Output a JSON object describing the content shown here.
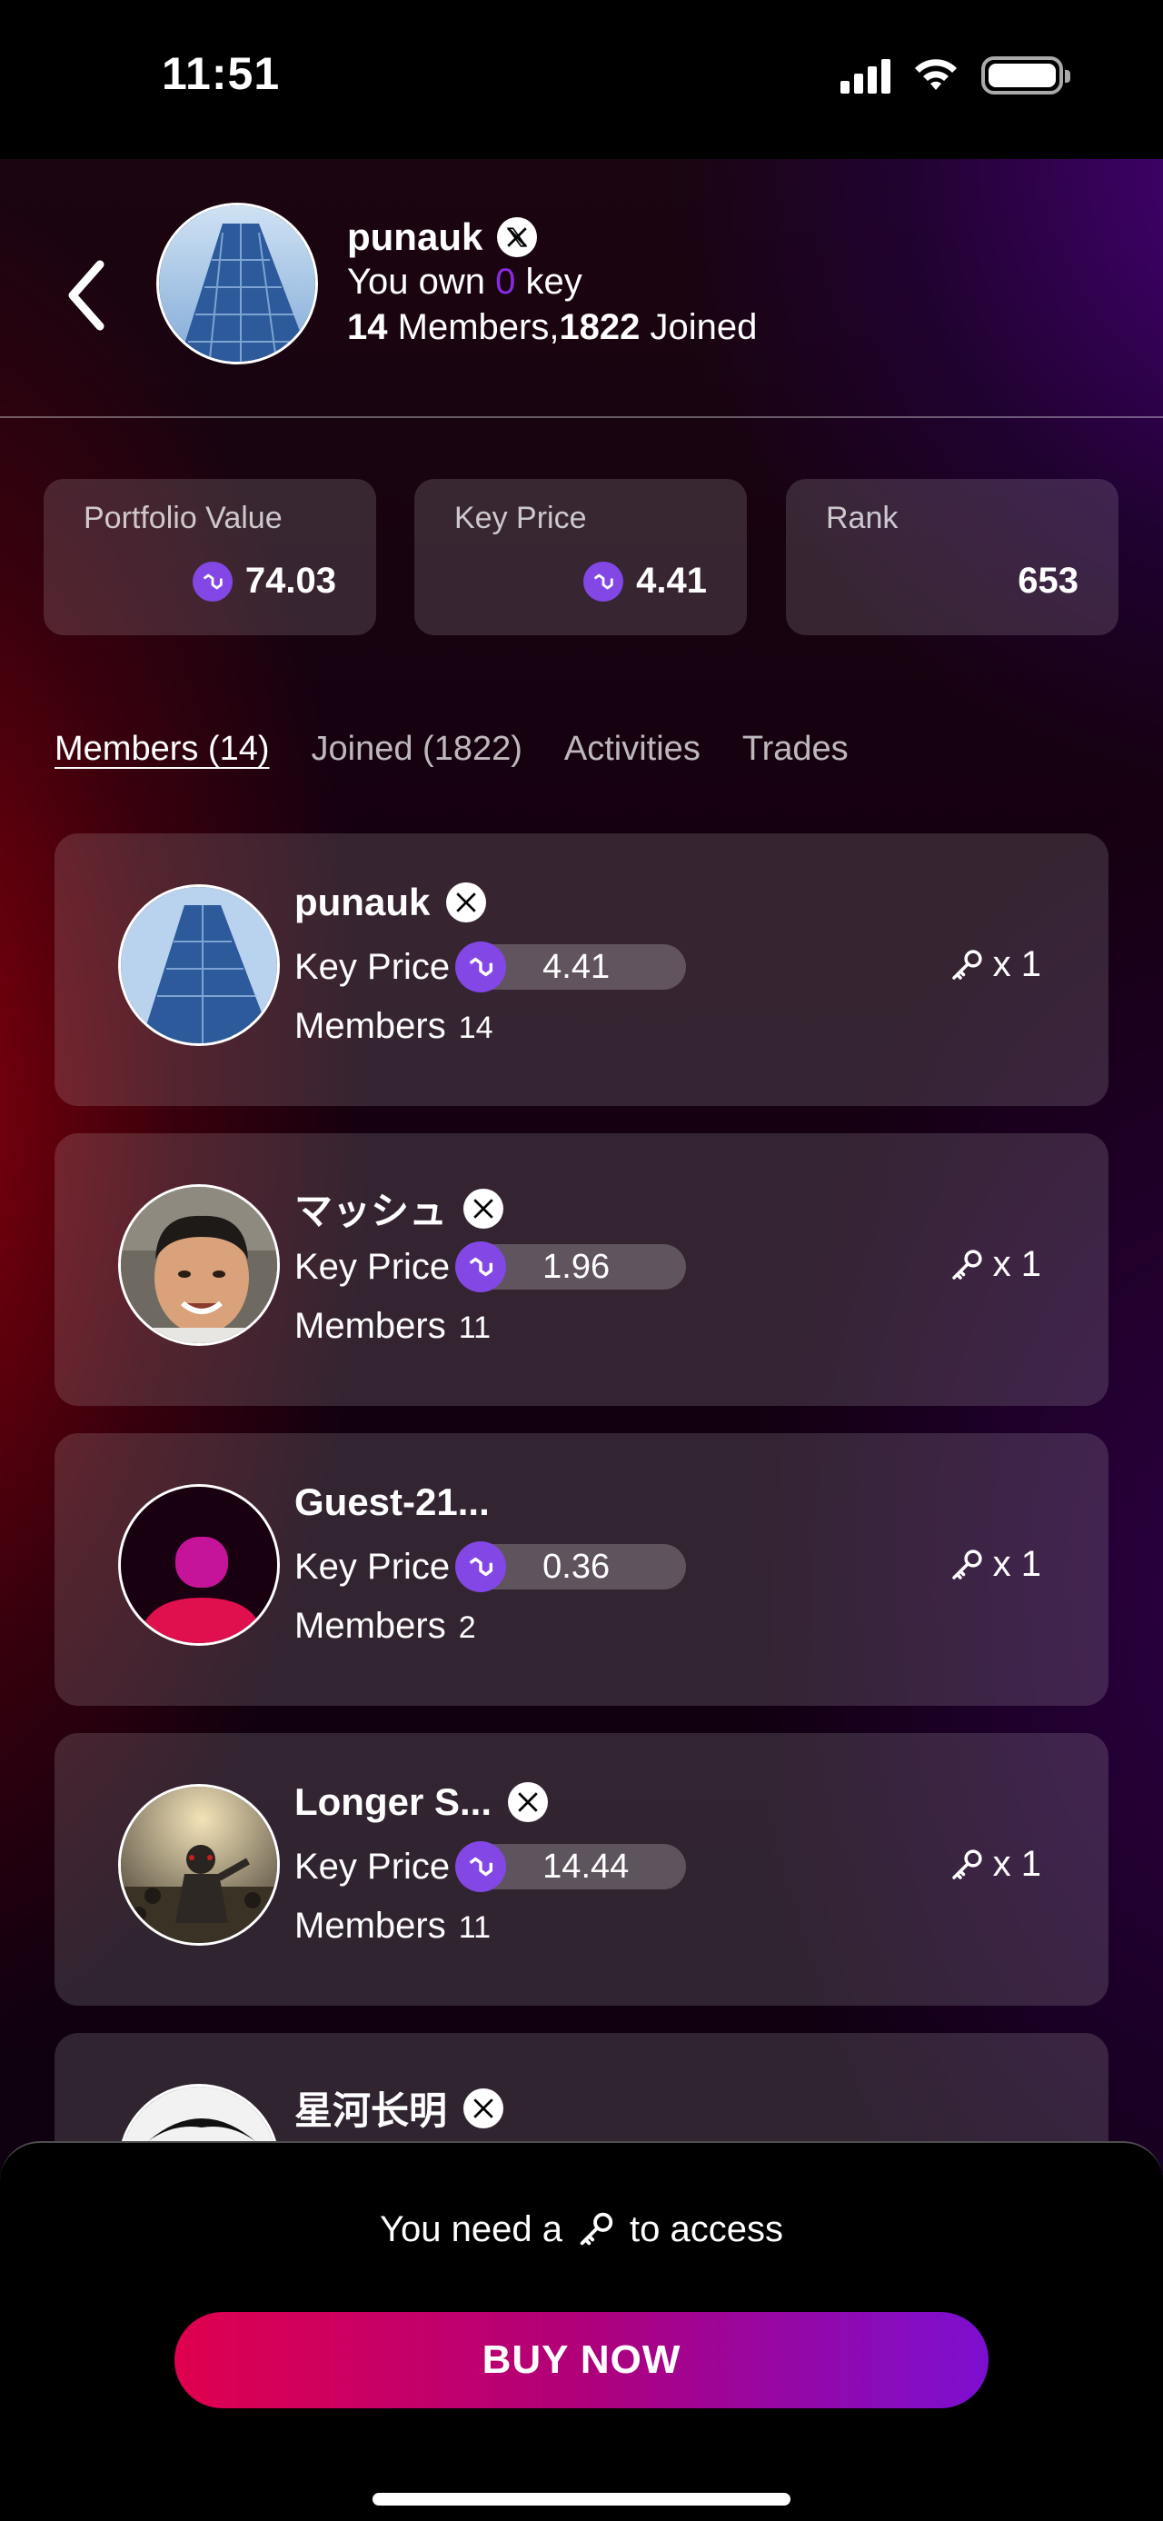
{
  "status_bar": {
    "time": "11:51"
  },
  "header": {
    "name": "punauk",
    "own_prefix": "You own",
    "own_count": "0",
    "own_suffix": "key",
    "members_count": "14",
    "members_label": "Members,",
    "joined_count": "1822",
    "joined_label": "Joined"
  },
  "stats": [
    {
      "label": "Portfolio Value",
      "value": "74.03",
      "icon": "polygon-coin-icon"
    },
    {
      "label": "Key Price",
      "value": "4.41",
      "icon": "polygon-coin-icon"
    },
    {
      "label": "Rank",
      "value": "653"
    }
  ],
  "tabs": [
    {
      "label": "Members (14)",
      "active": true
    },
    {
      "label": "Joined (1822)"
    },
    {
      "label": "Activities"
    },
    {
      "label": "Trades"
    }
  ],
  "members": [
    {
      "name": "punauk",
      "verified_x": true,
      "key_price_label": "Key Price",
      "key_price": "4.41",
      "members_label": "Members",
      "members_count": "14",
      "keys": "x 1"
    },
    {
      "name": "マッシュ",
      "verified_x": true,
      "key_price_label": "Key Price",
      "key_price": "1.96",
      "members_label": "Members",
      "members_count": "11",
      "keys": "x 1"
    },
    {
      "name": "Guest-21...",
      "verified_x": false,
      "key_price_label": "Key Price",
      "key_price": "0.36",
      "members_label": "Members",
      "members_count": "2",
      "keys": "x 1"
    },
    {
      "name": "Longer S...",
      "verified_x": true,
      "key_price_label": "Key Price",
      "key_price": "14.44",
      "members_label": "Members",
      "members_count": "11",
      "keys": "x 1"
    },
    {
      "name": "星河长明",
      "verified_x": true
    }
  ],
  "bottom_sheet": {
    "need_prefix": "You need a",
    "need_suffix": "to access",
    "buy_label": "BUY NOW"
  },
  "colors": {
    "accent_purple": "#8a2be2",
    "polygon": "#8247e5",
    "buy_gradient_start": "#e0004f",
    "buy_gradient_end": "#7c0fd0"
  }
}
